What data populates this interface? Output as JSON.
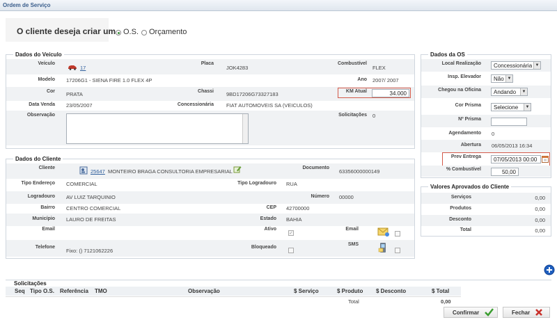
{
  "window": {
    "title": "Ordem de Serviço"
  },
  "create_prompt": {
    "label": "O cliente deseja criar um",
    "options": [
      {
        "label": "O.S.",
        "selected": true
      },
      {
        "label": "Orçamento",
        "selected": false
      }
    ]
  },
  "vehicle": {
    "title": "Dados do Veículo",
    "veiculo_label": "Veículo",
    "veiculo_value": "17",
    "placa_label": "Placa",
    "placa_value": "JOK4283",
    "combustivel_label": "Combustível",
    "combustivel_value": "FLEX",
    "modelo_label": "Modelo",
    "modelo_value": "17206G1 - SIENA FIRE 1.0 FLEX 4P",
    "ano_label": "Ano",
    "ano_value": "2007/ 2007",
    "cor_label": "Cor",
    "cor_value": "PRATA",
    "chassi_label": "Chassi",
    "chassi_value": "9BD17206G73327183",
    "km_label": "KM Atual",
    "km_value": "34.000",
    "data_venda_label": "Data Venda",
    "data_venda_value": "23/05/2007",
    "concessionaria_label": "Concessionária",
    "concessionaria_value": "FIAT AUTOMOVEIS SA (VEICULOS)",
    "observacao_label": "Observação",
    "observacao_value": "",
    "solicitacoes_label": "Solicitações",
    "solicitacoes_value": "0"
  },
  "client": {
    "title": "Dados do Cliente",
    "cliente_label": "Cliente",
    "cliente_code": "25647",
    "cliente_name": "MONTEIRO BRAGA CONSULTORIA EMPRESARIAL",
    "documento_label": "Documento",
    "documento_value": "63356000000149",
    "tipo_endereco_label": "Tipo Endereço",
    "tipo_endereco_value": "COMERCIAL",
    "tipo_logradouro_label": "Tipo Logradouro",
    "tipo_logradouro_value": "RUA",
    "logradouro_label": "Logradouro",
    "logradouro_value": "AV LUIZ TARQUINIO",
    "numero_label": "Número",
    "numero_value": "00000",
    "bairro_label": "Bairro",
    "bairro_value": "CENTRO COMERCIAL",
    "cep_label": "CEP",
    "cep_value": "42700000",
    "municipio_label": "Município",
    "municipio_value": "LAURO DE FREITAS",
    "estado_label": "Estado",
    "estado_value": "BAHIA",
    "email_label": "Email",
    "ativo_label": "Ativo",
    "email2_label": "Email",
    "telefone_label": "Telefone",
    "telefone_value": "Fixo: () 7121062226",
    "bloqueado_label": "Bloqueado",
    "sms_label": "SMS"
  },
  "os": {
    "title": "Dados da OS",
    "local_label": "Local Realização",
    "local_value": "Concessionária",
    "elevador_label": "Insp. Elevador",
    "elevador_value": "Não",
    "chegou_label": "Chegou na Oficina",
    "chegou_value": "Andando",
    "prisma_cor_label": "Cor Prisma",
    "prisma_cor_value": "Selecione",
    "prisma_num_label": "Nº Prisma",
    "prisma_num_value": "",
    "agendamento_label": "Agendamento",
    "agendamento_value": "0",
    "abertura_label": "Abertura",
    "abertura_value": "06/05/2013 16:34",
    "prev_entrega_label": "Prev Entrega",
    "prev_entrega_value": "07/05/2013 00:00",
    "combustivel_label": "% Combustível",
    "combustivel_value": "50,00"
  },
  "approved": {
    "title": "Valores Aprovados do Cliente",
    "rows": [
      {
        "label": "Serviços",
        "value": "0,00"
      },
      {
        "label": "Produtos",
        "value": "0,00"
      },
      {
        "label": "Desconto",
        "value": "0,00"
      },
      {
        "label": "Total",
        "value": "0,00"
      }
    ]
  },
  "requests": {
    "title": "Solicitações",
    "columns": [
      "Seq",
      "Tipo O.S.",
      "Referência",
      "TMO",
      "Observação",
      "$ Serviço",
      "$ Produto",
      "$ Desconto",
      "$ Total"
    ],
    "total_label": "Total",
    "total_value": "0,00"
  },
  "buttons": {
    "confirm": "Confirmar",
    "close": "Fechar"
  },
  "icons": {
    "car": "car-icon",
    "client": "client-card-icon",
    "edit": "edit-pencil-icon",
    "calendar": "calendar-icon",
    "email": "envelope-icon",
    "sms": "phone-icon",
    "add": "add-circle-icon",
    "check": "check-icon",
    "close": "close-x-icon"
  },
  "colors": {
    "title_text": "#3b5e8c",
    "highlight_border": "#d35a4a",
    "link": "#2f5f9c",
    "confirm_green": "#3a9d2f",
    "close_red": "#c8302a",
    "add_blue": "#1f5fbf"
  }
}
